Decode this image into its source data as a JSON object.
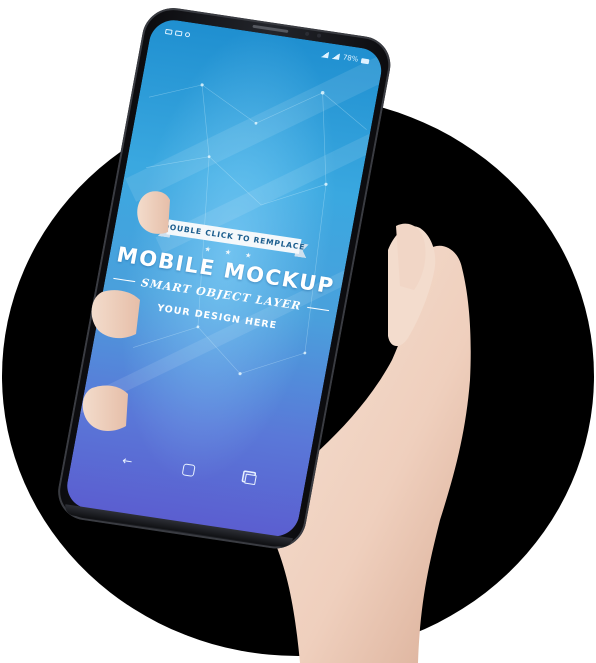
{
  "mockup": {
    "ribbon_text": "DOUBLE CLICK TO REMPLACE",
    "stars": "★ ★ ★",
    "title": "MOBILE MOCKUP",
    "subtitle": "SMART OBJECT LAYER",
    "tagline": "YOUR DESIGN HERE"
  },
  "statusbar": {
    "battery": "78%"
  },
  "navbar": {
    "back": "←"
  },
  "colors": {
    "background_circle": "#000000",
    "screen_top": "#1f8fd0",
    "screen_bottom": "#5b5ed0",
    "phone_frame": "#16171b",
    "skin": "#f1d8c8",
    "text": "#ffffff"
  }
}
